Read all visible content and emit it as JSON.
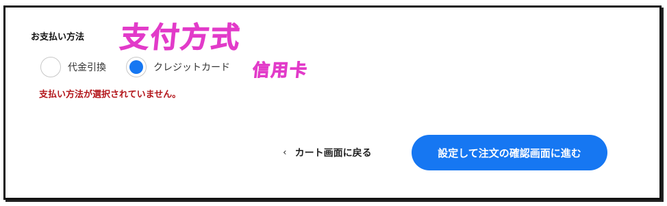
{
  "payment": {
    "title": "お支払い方法",
    "options": [
      {
        "label": "代金引換",
        "selected": false
      },
      {
        "label": "クレジットカード",
        "selected": true
      }
    ],
    "error": "支払い方法が選択されていません。"
  },
  "annotations": {
    "main": "支付方式",
    "card": "信用卡",
    "color": "#e23bc9"
  },
  "actions": {
    "back_label": "カート画面に戻る",
    "back_icon": "chevron-left-icon",
    "primary_label": "設定して注文の確認画面に進む",
    "primary_color": "#1677f2"
  }
}
